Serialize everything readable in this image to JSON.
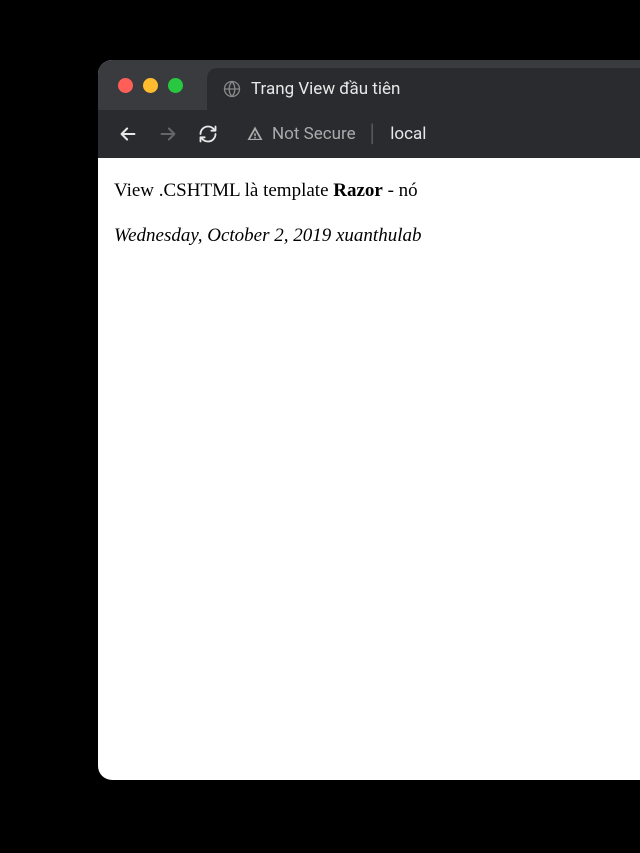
{
  "browser": {
    "tab_title": "Trang View đầu tiên",
    "security_label": "Not Secure",
    "url_visible": "local"
  },
  "page": {
    "line1_pre": "View .CSHTML là template ",
    "line1_bold": "Razor",
    "line1_post": " - nó",
    "line2": "Wednesday, October 2, 2019 xuanthulab"
  }
}
